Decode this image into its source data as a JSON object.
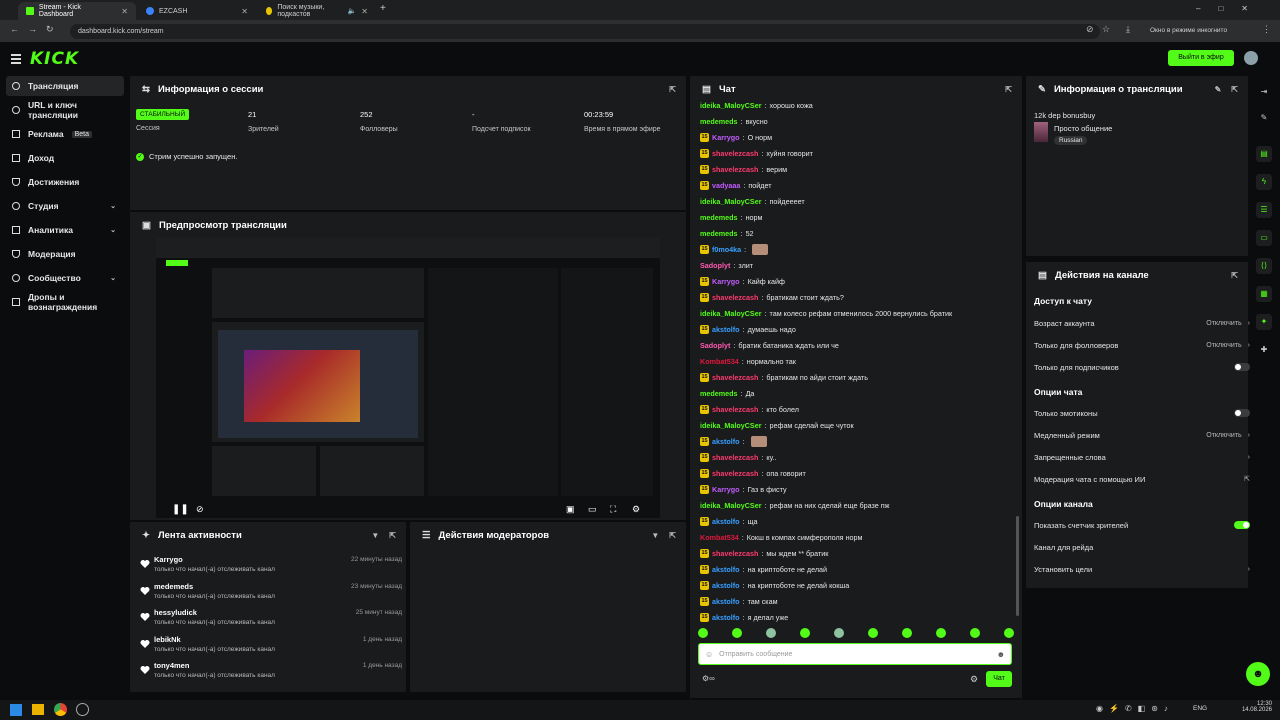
{
  "browser": {
    "tabs": [
      {
        "title": "Stream - Kick Dashboard",
        "active": true
      },
      {
        "title": "EZCASH",
        "active": false
      },
      {
        "title": "Поиск музыки, подкастов",
        "active": false
      }
    ],
    "url": "dashboard.kick.com/stream",
    "incognito_label": "Окно в режиме инкогнито"
  },
  "header": {
    "logo": "KICK",
    "go_live_label": "Выйти в эфир"
  },
  "sidebar": {
    "items": [
      {
        "label": "Трансляция",
        "icon": "broadcast-icon",
        "active": true
      },
      {
        "label": "URL и ключ трансляции",
        "icon": "key-icon"
      },
      {
        "label": "Реклама",
        "icon": "ads-icon",
        "badge": "Beta"
      },
      {
        "label": "Доход",
        "icon": "money-icon"
      },
      {
        "label": "Достижения",
        "icon": "trophy-icon"
      },
      {
        "label": "Студия",
        "icon": "studio-icon",
        "chevron": true
      },
      {
        "label": "Аналитика",
        "icon": "chart-icon",
        "chevron": true
      },
      {
        "label": "Модерация",
        "icon": "shield-icon"
      },
      {
        "label": "Сообщество",
        "icon": "community-icon",
        "chevron": true
      },
      {
        "label": "Дропы и вознаграждения",
        "icon": "gift-icon"
      }
    ]
  },
  "session": {
    "title": "Информация о сессии",
    "status_badge": "СТАБИЛЬНЫЙ",
    "stats": [
      {
        "value": "",
        "label": "Сессия"
      },
      {
        "value": "21",
        "label": "Зрителей"
      },
      {
        "value": "252",
        "label": "Фолловеры"
      },
      {
        "value": "-",
        "label": "Подсчет подписок"
      },
      {
        "value": "00:23:59",
        "label": "Время в прямом эфире"
      }
    ],
    "message": "Стрим успешно запущен."
  },
  "preview": {
    "title": "Предпросмотр трансляции"
  },
  "activity": {
    "title": "Лента активности",
    "items": [
      {
        "name": "Karrygo",
        "text": "только что начал(-а) отслеживать канал",
        "time": "22 минуты назад"
      },
      {
        "name": "medemeds",
        "text": "только что начал(-а) отслеживать канал",
        "time": "23 минуты назад"
      },
      {
        "name": "hessyludick",
        "text": "только что начал(-а) отслеживать канал",
        "time": "25 минут назад"
      },
      {
        "name": "lebikNk",
        "text": "только что начал(-а) отслеживать канал",
        "time": "1 день назад"
      },
      {
        "name": "tony4men",
        "text": "только что начал(-а) отслеживать канал",
        "time": "1 день назад"
      }
    ]
  },
  "mod_actions": {
    "title": "Действия модераторов"
  },
  "chat": {
    "title": "Чат",
    "messages": [
      {
        "user": "ideika_MaloyCSer",
        "text": "хорошо кожа",
        "color": "#53fc18",
        "badge": false
      },
      {
        "user": "medemeds",
        "text": "вкусно",
        "color": "#53fc18",
        "badge": false
      },
      {
        "user": "Karrygo",
        "text": "О норм",
        "color": "#c45cff",
        "badge": true
      },
      {
        "user": "shavelezcash",
        "text": "хуйня говорит",
        "color": "#ff3a6e",
        "badge": true
      },
      {
        "user": "shavelezcash",
        "text": "верим",
        "color": "#ff3a6e",
        "badge": true
      },
      {
        "user": "vadyaaa",
        "text": "пойдет",
        "color": "#c45cff",
        "badge": true
      },
      {
        "user": "ideika_MaloyCSer",
        "text": "пойдеееет",
        "color": "#53fc18",
        "badge": false
      },
      {
        "user": "medemeds",
        "text": "норм",
        "color": "#53fc18",
        "badge": false
      },
      {
        "user": "medemeds",
        "text": "52",
        "color": "#53fc18",
        "badge": false
      },
      {
        "user": "f0mo4ka",
        "text": "",
        "color": "#38a0ff",
        "badge": true
      },
      {
        "user": "Sadoplyt",
        "text": "злит",
        "color": "#ff5ab4",
        "badge": false
      },
      {
        "user": "Karrygo",
        "text": "Кайф кайф",
        "color": "#c45cff",
        "badge": true
      },
      {
        "user": "shavelezcash",
        "text": "братикам стоит ждать?",
        "color": "#ff3a6e",
        "badge": true
      },
      {
        "user": "ideika_MaloyCSer",
        "text": "там колесо рефам отменилось 2000 вернулись братик",
        "color": "#53fc18",
        "badge": false
      },
      {
        "user": "akstolfo",
        "text": "думаешь надо",
        "color": "#38a0ff",
        "badge": true
      },
      {
        "user": "Sadoplyt",
        "text": "братик батаника ждать или че",
        "color": "#ff5ab4",
        "badge": false
      },
      {
        "user": "Kombat534",
        "text": "нормально так",
        "color": "#e2183d",
        "badge": false
      },
      {
        "user": "shavelezcash",
        "text": "братикам по айди стоит ждать",
        "color": "#ff3a6e",
        "badge": true
      },
      {
        "user": "medemeds",
        "text": "Да",
        "color": "#53fc18",
        "badge": false
      },
      {
        "user": "shavelezcash",
        "text": "кто болел",
        "color": "#ff3a6e",
        "badge": true
      },
      {
        "user": "ideika_MaloyCSer",
        "text": "рефам сделай еще чуток",
        "color": "#53fc18",
        "badge": false
      },
      {
        "user": "akstolfo",
        "text": "",
        "color": "#38a0ff",
        "badge": true
      },
      {
        "user": "shavelezcash",
        "text": "ку..",
        "color": "#ff3a6e",
        "badge": true
      },
      {
        "user": "shavelezcash",
        "text": "опа говорит",
        "color": "#ff3a6e",
        "badge": true
      },
      {
        "user": "Karrygo",
        "text": "Газ в фисту",
        "color": "#c45cff",
        "badge": true
      },
      {
        "user": "ideika_MaloyCSer",
        "text": "рефам на них сделай еще бразе пж",
        "color": "#53fc18",
        "badge": false
      },
      {
        "user": "akstolfo",
        "text": "ща",
        "color": "#38a0ff",
        "badge": true
      },
      {
        "user": "Kombat534",
        "text": "Кокш в компах симферополя норм",
        "color": "#e2183d",
        "badge": false
      },
      {
        "user": "shavelezcash",
        "text": "мы ждем ** братик",
        "color": "#ff3a6e",
        "badge": true
      },
      {
        "user": "akstolfo",
        "text": "на криптоботе не делай",
        "color": "#38a0ff",
        "badge": true
      },
      {
        "user": "akstolfo",
        "text": "на криптоботе не делай кокша",
        "color": "#38a0ff",
        "badge": true
      },
      {
        "user": "akstolfo",
        "text": "там скам",
        "color": "#38a0ff",
        "badge": true
      },
      {
        "user": "akstolfo",
        "text": "я делал уже",
        "color": "#38a0ff",
        "badge": true
      }
    ],
    "input_placeholder": "Отправить сообщение",
    "send_label": "Чат"
  },
  "stream_info": {
    "title": "Информация о трансляции",
    "stream_title": "12k dep bonusbuy",
    "category": "Просто общение",
    "language": "Russian"
  },
  "channel_actions": {
    "title": "Действия на канале",
    "chat_access_title": "Доступ к чату",
    "chat_access": [
      {
        "label": "Возраст аккаунта",
        "value": "Отключить",
        "control": "chevron"
      },
      {
        "label": "Только для фолловеров",
        "value": "Отключить",
        "control": "chevron"
      },
      {
        "label": "Только для подписчиков",
        "value": "",
        "control": "toggle-off"
      }
    ],
    "chat_options_title": "Опции чата",
    "chat_options": [
      {
        "label": "Только эмотиконы",
        "value": "",
        "control": "toggle-off"
      },
      {
        "label": "Медленный режим",
        "value": "Отключить",
        "control": "chevron"
      },
      {
        "label": "Запрещенные слова",
        "value": "",
        "control": "chevron"
      },
      {
        "label": "Модерация чата с помощью ИИ",
        "value": "",
        "control": "external"
      }
    ],
    "channel_options_title": "Опции канала",
    "channel_options": [
      {
        "label": "Показать счетчик зрителей",
        "value": "",
        "control": "toggle-on"
      },
      {
        "label": "Канал для рейда",
        "value": "",
        "control": "none"
      },
      {
        "label": "Установить цели",
        "value": "",
        "control": "chevron"
      }
    ]
  },
  "taskbar": {
    "lang": "ENG",
    "time": "12:30",
    "date": "14.08.2026"
  },
  "colors": {
    "accent": "#53fc18",
    "bg": "#0b0c0d",
    "panel": "#191b1c"
  }
}
